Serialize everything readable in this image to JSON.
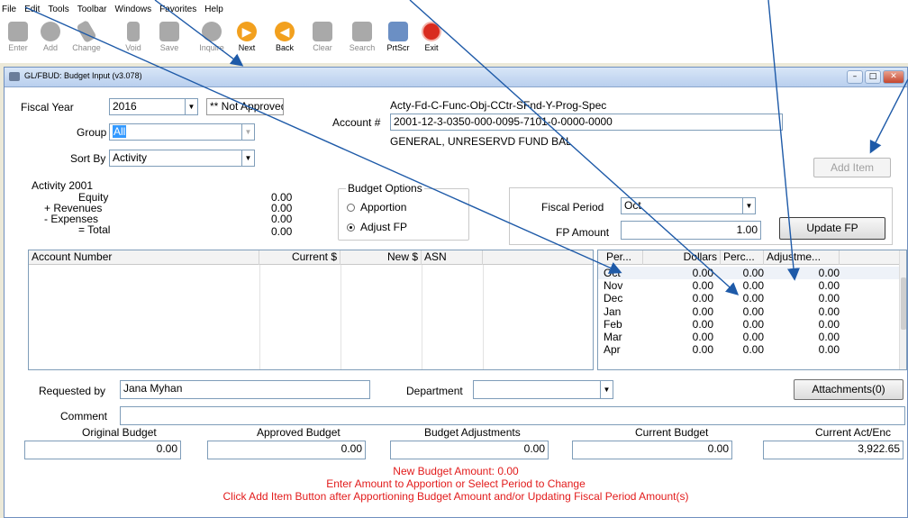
{
  "menu": [
    "File",
    "Edit",
    "Tools",
    "Toolbar",
    "Windows",
    "Favorites",
    "Help"
  ],
  "toolbar": [
    {
      "label": "Enter",
      "icon": "enter-icon",
      "enabled": false
    },
    {
      "label": "Add",
      "icon": "add-icon",
      "enabled": false
    },
    {
      "label": "Change",
      "icon": "change-icon",
      "enabled": false
    },
    {
      "label": "Void",
      "icon": "void-icon",
      "enabled": false
    },
    {
      "label": "Save",
      "icon": "save-icon",
      "enabled": false
    },
    {
      "label": "Inquire",
      "icon": "inquire-icon",
      "enabled": false
    },
    {
      "label": "Next",
      "icon": "next-icon",
      "enabled": true
    },
    {
      "label": "Back",
      "icon": "back-icon",
      "enabled": true
    },
    {
      "label": "Clear",
      "icon": "clear-icon",
      "enabled": false
    },
    {
      "label": "Search",
      "icon": "search-icon",
      "enabled": false
    },
    {
      "label": "PrtScr",
      "icon": "printer-icon",
      "enabled": true
    },
    {
      "label": "Exit",
      "icon": "exit-icon",
      "enabled": true
    }
  ],
  "window": {
    "title": "GL/FBUD: Budget Input (v3.078)"
  },
  "form": {
    "fiscal_year_label": "Fiscal Year",
    "fiscal_year": "2016",
    "approval_status": "** Not Approved **",
    "group_label": "Group",
    "group_value": "All",
    "sort_by_label": "Sort By",
    "sort_by_value": "Activity",
    "account_format": "Acty-Fd-C-Func-Obj-CCtr-SFnd-Y-Prog-Spec",
    "account_label": "Account #",
    "account_value": "2001-12-3-0350-000-0095-7101-0-0000-0000",
    "account_desc": "GENERAL, UNRESERVD FUND BAL",
    "add_item": "Add Item"
  },
  "activity": {
    "heading": "Activity 2001",
    "rows": [
      {
        "label": "Equity",
        "value": "0.00"
      },
      {
        "label": "+ Revenues",
        "value": "0.00"
      },
      {
        "label": "- Expenses",
        "value": "0.00"
      },
      {
        "label": "= Total",
        "value": "0.00"
      }
    ]
  },
  "budget_options": {
    "legend": "Budget Options",
    "apportion": "Apportion",
    "adjust_fp": "Adjust FP",
    "selected": "adjust_fp"
  },
  "fiscal_period": {
    "label": "Fiscal Period",
    "value": "Oct",
    "amount_label": "FP Amount",
    "amount": "1.00",
    "update_button": "Update FP"
  },
  "accounts_table": {
    "columns": [
      "Account Number",
      "Current $",
      "New $",
      "ASN"
    ],
    "rows": []
  },
  "periods_table": {
    "columns": [
      "Per...",
      "Dollars",
      "Perc...",
      "Adjustme..."
    ],
    "rows": [
      {
        "per": "Oct",
        "dollars": "0.00",
        "perc": "0.00",
        "adj": "0.00"
      },
      {
        "per": "Nov",
        "dollars": "0.00",
        "perc": "0.00",
        "adj": "0.00"
      },
      {
        "per": "Dec",
        "dollars": "0.00",
        "perc": "0.00",
        "adj": "0.00"
      },
      {
        "per": "Jan",
        "dollars": "0.00",
        "perc": "0.00",
        "adj": "0.00"
      },
      {
        "per": "Feb",
        "dollars": "0.00",
        "perc": "0.00",
        "adj": "0.00"
      },
      {
        "per": "Mar",
        "dollars": "0.00",
        "perc": "0.00",
        "adj": "0.00"
      },
      {
        "per": "Apr",
        "dollars": "0.00",
        "perc": "0.00",
        "adj": "0.00"
      }
    ]
  },
  "footer": {
    "requested_by_label": "Requested by",
    "requested_by": "Jana Myhan",
    "department_label": "Department",
    "department": "",
    "attachments": "Attachments(0)",
    "comment_label": "Comment",
    "comment": ""
  },
  "totals": [
    {
      "label": "Original Budget",
      "value": "0.00"
    },
    {
      "label": "Approved Budget",
      "value": "0.00"
    },
    {
      "label": "Budget Adjustments",
      "value": "0.00"
    },
    {
      "label": "Current Budget",
      "value": "0.00"
    },
    {
      "label": "Current Act/Enc",
      "value": "3,922.65"
    }
  ],
  "messages": [
    "New Budget Amount: 0.00",
    "Enter Amount to Apportion or Select Period to Change",
    "Click Add Item Button after Apportioning Budget Amount and/or Updating Fiscal Period Amount(s)"
  ],
  "colors": {
    "accent": "#1e50b8",
    "message": "#e21b1b",
    "arrow": "#1e5aa8"
  }
}
